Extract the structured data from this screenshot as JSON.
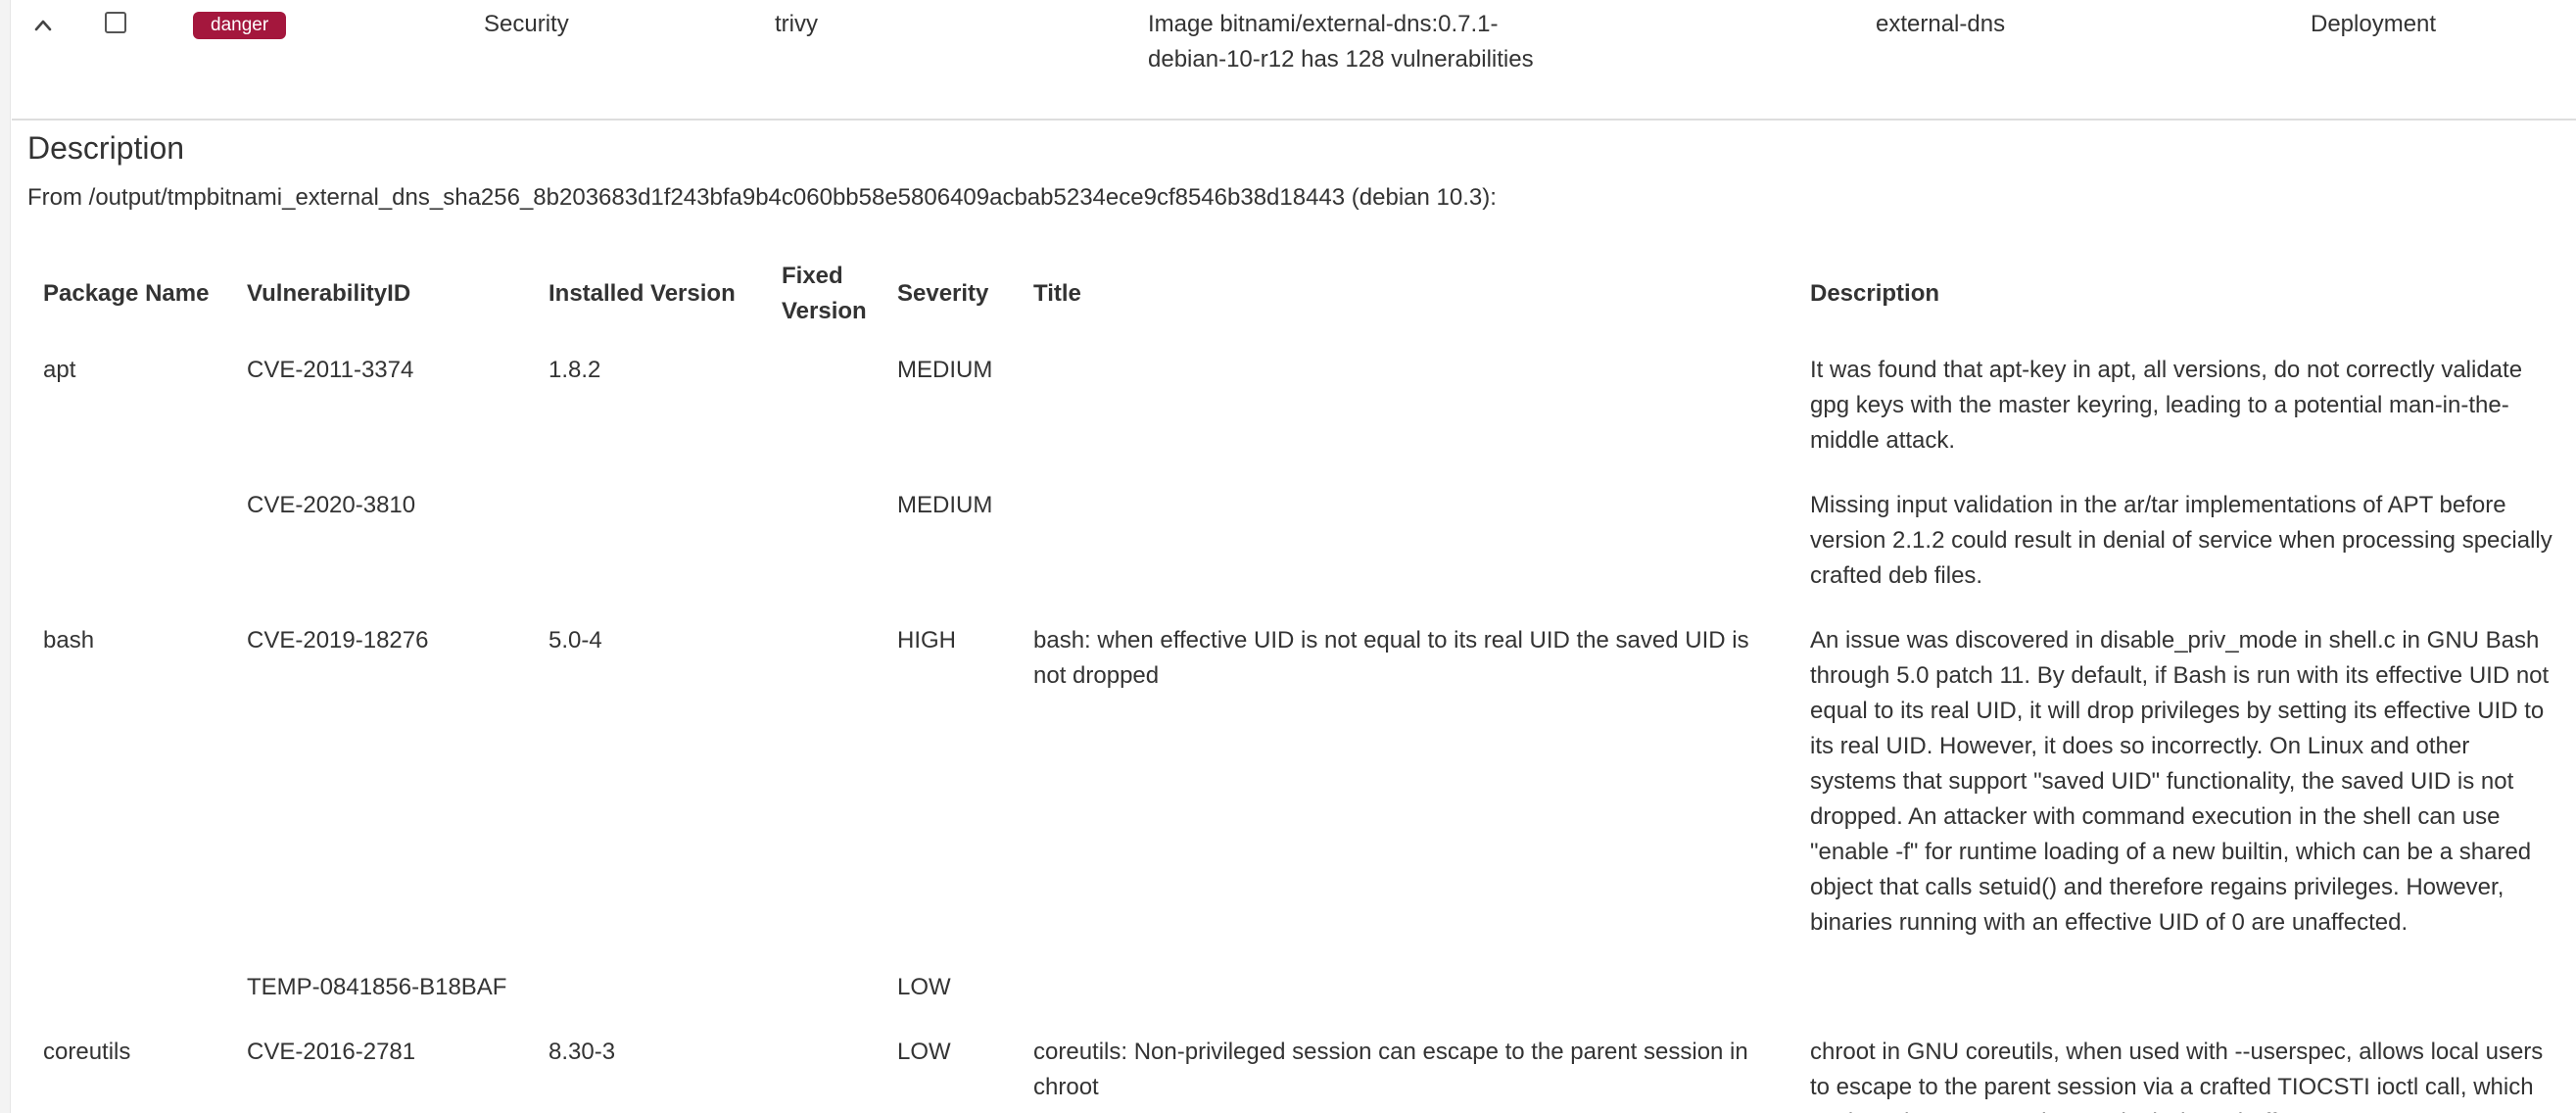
{
  "summary": {
    "severity_badge": "danger",
    "category": "Security",
    "tool": "trivy",
    "message": "Image bitnami/external-dns:0.7.1-debian-10-r12 has 128 vulnerabilities",
    "resource": "external-dns",
    "kind": "Deployment",
    "colors": {
      "badge": "#a4173d"
    }
  },
  "details": {
    "heading": "Description",
    "from_text": "From /output/tmpbitnami_external_dns_sha256_8b203683d1f243bfa9b4c060bb58e5806409acbab5234ece9cf8546b38d18443 (debian 10.3):",
    "table": {
      "headers": {
        "package": "Package Name",
        "vuln_id": "VulnerabilityID",
        "installed": "Installed Version",
        "fixed": "Fixed Version",
        "severity": "Severity",
        "title": "Title",
        "description": "Description"
      },
      "rows": [
        {
          "package": "apt",
          "vuln_id": "CVE-2011-3374",
          "installed": "1.8.2",
          "fixed": "",
          "severity": "MEDIUM",
          "title": "",
          "description": "It was found that apt-key in apt, all versions, do not correctly validate gpg keys with the master keyring, leading to a potential man-in-the-middle attack."
        },
        {
          "package": "",
          "vuln_id": "CVE-2020-3810",
          "installed": "",
          "fixed": "",
          "severity": "MEDIUM",
          "title": "",
          "description": "Missing input validation in the ar/tar implementations of APT before version 2.1.2 could result in denial of service when processing specially crafted deb files."
        },
        {
          "package": "bash",
          "vuln_id": "CVE-2019-18276",
          "installed": "5.0-4",
          "fixed": "",
          "severity": "HIGH",
          "title": "bash: when effective UID is not equal to its real UID the saved UID is not dropped",
          "description": "An issue was discovered in disable_priv_mode in shell.c in GNU Bash through 5.0 patch 11. By default, if Bash is run with its effective UID not equal to its real UID, it will drop privileges by setting its effective UID to its real UID. However, it does so incorrectly. On Linux and other systems that support \"saved UID\" functionality, the saved UID is not dropped. An attacker with command execution in the shell can use \"enable -f\" for runtime loading of a new builtin, which can be a shared object that calls setuid() and therefore regains privileges. However, binaries running with an effective UID of 0 are unaffected."
        },
        {
          "package": "",
          "vuln_id": "TEMP-0841856-B18BAF",
          "installed": "",
          "fixed": "",
          "severity": "LOW",
          "title": "",
          "description": ""
        },
        {
          "package": "coreutils",
          "vuln_id": "CVE-2016-2781",
          "installed": "8.30-3",
          "fixed": "",
          "severity": "LOW",
          "title": "coreutils: Non-privileged session can escape to the parent session in chroot",
          "description": "chroot in GNU coreutils, when used with --userspec, allows local users to escape to the parent session via a crafted TIOCSTI ioctl call, which pushes characters to the terminal's input buffer."
        }
      ]
    }
  }
}
